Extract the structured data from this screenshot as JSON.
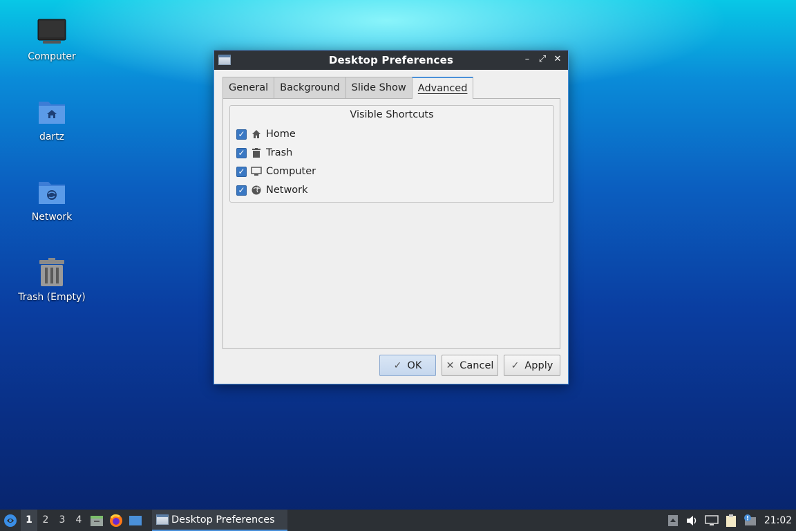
{
  "desktop": {
    "icons": [
      {
        "label": "Computer",
        "icon": "computer-icon"
      },
      {
        "label": "dartz",
        "icon": "home-folder-icon"
      },
      {
        "label": "Network",
        "icon": "network-folder-icon"
      },
      {
        "label": "Trash (Empty)",
        "icon": "trash-icon"
      }
    ]
  },
  "dialog": {
    "title": "Desktop Preferences",
    "controls": {
      "minimize": "–",
      "maximize": "⤢",
      "close": "✕"
    },
    "tabs": [
      {
        "label": "General",
        "active": false
      },
      {
        "label": "Background",
        "active": false
      },
      {
        "label": "Slide Show",
        "active": false
      },
      {
        "label": "Advanced",
        "active": true
      }
    ],
    "group": {
      "title": "Visible Shortcuts",
      "items": [
        {
          "label": "Home",
          "checked": true,
          "icon": "home-icon"
        },
        {
          "label": "Trash",
          "checked": true,
          "icon": "trash-icon"
        },
        {
          "label": "Computer",
          "checked": true,
          "icon": "computer-icon"
        },
        {
          "label": "Network",
          "checked": true,
          "icon": "network-icon"
        }
      ]
    },
    "buttons": {
      "ok": "OK",
      "cancel": "Cancel",
      "apply": "Apply"
    }
  },
  "taskbar": {
    "workspaces": [
      "1",
      "2",
      "3",
      "4"
    ],
    "active_workspace": "1",
    "task_label": "Desktop Preferences",
    "clock": "21:02"
  },
  "colors": {
    "accent": "#4a90d9",
    "taskbar": "#2c3035",
    "titlebar": "#2f3338"
  }
}
